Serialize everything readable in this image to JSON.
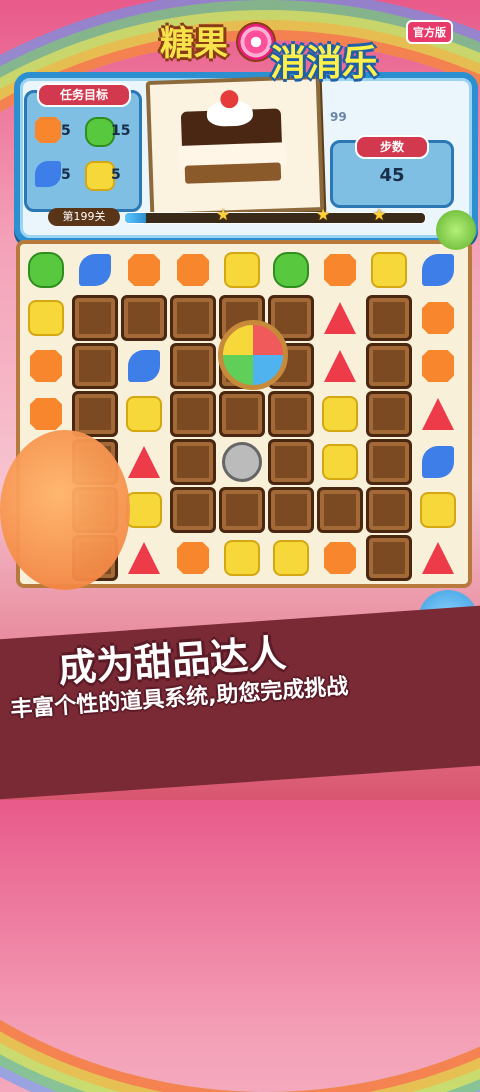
{
  "logo": {
    "part1": "糖果",
    "part2": "消消乐",
    "tag": "官方版"
  },
  "goals": {
    "title": "任务目标",
    "items": [
      {
        "candy": "orange",
        "count": "5"
      },
      {
        "candy": "green",
        "count": "15"
      },
      {
        "candy": "blue",
        "count": "5"
      },
      {
        "candy": "yellow",
        "count": "5"
      }
    ]
  },
  "score": "99",
  "steps": {
    "title": "步数",
    "value": "45"
  },
  "level": {
    "label": "第199关",
    "progress": 0.07
  },
  "board": {
    "rows": [
      [
        "green",
        "blue",
        "orange",
        "orange",
        "yellow",
        "green",
        "orange",
        "yellow",
        "blue"
      ],
      [
        "yellow",
        "choc",
        "choc",
        "choc",
        "choc",
        "choc",
        "red",
        "choc",
        "orange"
      ],
      [
        "orange",
        "choc",
        "blue",
        "choc",
        "pie",
        "choc",
        "red",
        "choc",
        "orange"
      ],
      [
        "orange",
        "choc",
        "yellow",
        "choc",
        "choc",
        "choc",
        "yellow",
        "choc",
        "red"
      ],
      [
        "",
        "choc",
        "red",
        "choc",
        "stopper",
        "choc",
        "yellow",
        "choc",
        "blue"
      ],
      [
        "",
        "choc",
        "yellow",
        "choc",
        "choc",
        "choc",
        "choc",
        "choc",
        "yellow"
      ],
      [
        "",
        "choc",
        "red",
        "orange",
        "yellow",
        "yellow",
        "orange",
        "choc",
        "red"
      ]
    ]
  },
  "banner": {
    "slogan": "成为甜品达人",
    "subline": "丰富个性的道具系统,助您完成挑战"
  },
  "colors": {
    "frame": "#2b8fd0",
    "title_badge": "#d3394e",
    "banner": "#7a2a35"
  }
}
